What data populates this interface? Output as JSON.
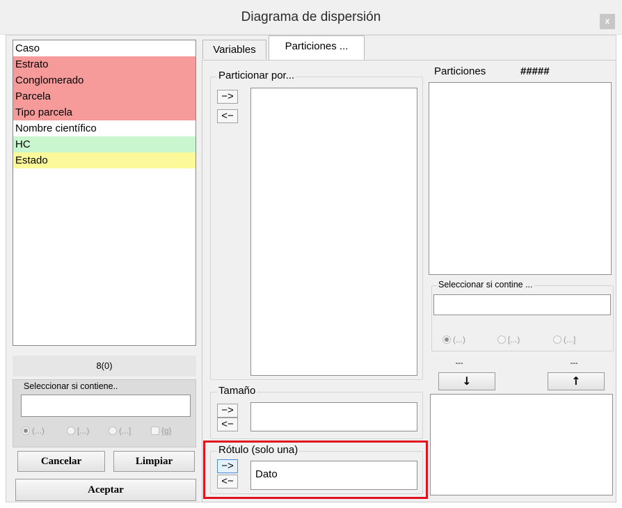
{
  "window": {
    "title": "Diagrama de dispersión",
    "close_label": "x"
  },
  "variables": {
    "items": [
      {
        "label": "Caso",
        "color": "#ffffff"
      },
      {
        "label": "Estrato",
        "color": "#f79a9a"
      },
      {
        "label": "Conglomerado",
        "color": "#f79a9a"
      },
      {
        "label": "Parcela",
        "color": "#f79a9a"
      },
      {
        "label": "Tipo parcela",
        "color": "#f79a9a"
      },
      {
        "label": "Nombre científico",
        "color": "#ffffff"
      },
      {
        "label": "HC",
        "color": "#c9f5cf"
      },
      {
        "label": "Estado",
        "color": "#fbf99a"
      }
    ],
    "count": "8(0)"
  },
  "left_filter": {
    "label": "Seleccionar si contiene..",
    "value": "",
    "options": [
      "(...)",
      "[...)",
      "(...]",
      "{g}"
    ],
    "selected": "(...)"
  },
  "buttons": {
    "cancel": "Cancelar",
    "clear": "Limpiar",
    "accept": "Aceptar"
  },
  "tabs": [
    {
      "label": "Variables",
      "selected": false
    },
    {
      "label": "Particiones ...",
      "selected": true
    }
  ],
  "partition_by": {
    "label": "Particionar por...",
    "add": "−>",
    "remove": "<−",
    "items": []
  },
  "size": {
    "label": "Tamaño",
    "add": "−>",
    "remove": "<−",
    "value": ""
  },
  "label_group": {
    "label": "Rótulo (solo una)",
    "add": "−>",
    "remove": "<−",
    "value": "Dato"
  },
  "partitions": {
    "label": "Particiones",
    "hash": "#####",
    "filter_label": "Seleccionar si contine ...",
    "filter_value": "",
    "options": [
      "(...)",
      "[...)",
      "(...]"
    ],
    "selected": "(...)",
    "down_caption": "---",
    "up_caption": "---",
    "down_label": "↓",
    "up_label": "↑"
  },
  "highlight_color": "#e0141e"
}
